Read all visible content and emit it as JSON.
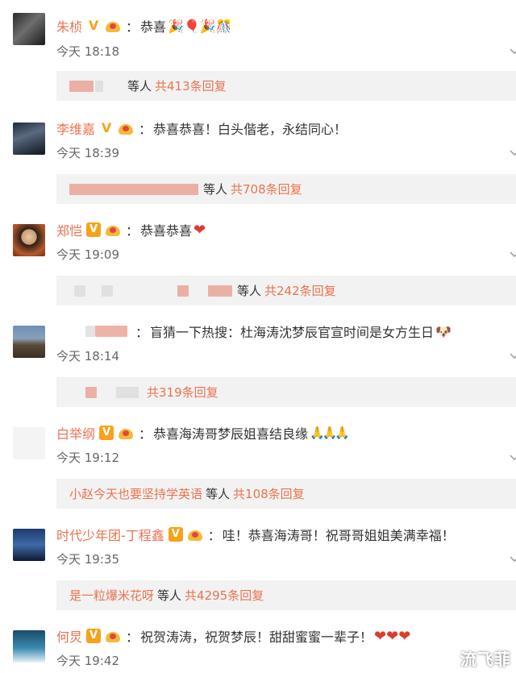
{
  "colors": {
    "accent": "#eb7350",
    "text": "#333333",
    "time": "#666666",
    "reply_bg": "#f2f2f2"
  },
  "comments": [
    {
      "username": "朱桢",
      "badge": "V",
      "text": "恭喜",
      "emoji": "🎉🎈🎉🎊",
      "time": "今天 18:18",
      "reply": {
        "replier": "",
        "dengren": "等人",
        "total": "共413条回复"
      }
    },
    {
      "username": "李维嘉",
      "badge": "V",
      "text": "恭喜恭喜！白头偕老，永结同心！",
      "emoji": "",
      "time": "今天 18:39",
      "reply": {
        "replier": "",
        "dengren": "等人",
        "total": "共708条回复"
      }
    },
    {
      "username": "郑恺",
      "badge": "V",
      "text": "恭喜恭喜",
      "emoji": "❤",
      "time": "今天 19:09",
      "reply": {
        "replier": "",
        "dengren": "等人",
        "total": "共242条回复"
      }
    },
    {
      "username": "",
      "badge": "",
      "text": "盲猜一下热搜：杜海涛沈梦辰官宣时间是女方生日",
      "emoji": "🐶",
      "time": "今天 18:14",
      "reply": {
        "replier": "",
        "dengren": "",
        "total": "共319条回复"
      }
    },
    {
      "username": "白举纲",
      "badge": "V",
      "text": "恭喜海涛哥梦辰姐喜结良缘",
      "emoji": "🙏🙏🙏",
      "time": "今天 19:12",
      "reply": {
        "replier": "小赵今天也要坚持学英语",
        "dengren": "等人",
        "total": "共108条回复"
      }
    },
    {
      "username": "时代少年团-丁程鑫",
      "badge": "V",
      "text": "哇！恭喜海涛哥！祝哥哥姐姐美满幸福！",
      "emoji": "",
      "time": "今天 19:35",
      "reply": {
        "replier": "是一粒爆米花呀",
        "dengren": "等人",
        "total": "共4295条回复"
      }
    },
    {
      "username": "何炅",
      "badge": "V",
      "text": "祝贺涛涛，祝贺梦辰！甜甜蜜蜜一辈子！",
      "emoji": "❤❤❤",
      "time": "今天 19:42",
      "reply": null
    }
  ],
  "watermark": "流飞菲"
}
